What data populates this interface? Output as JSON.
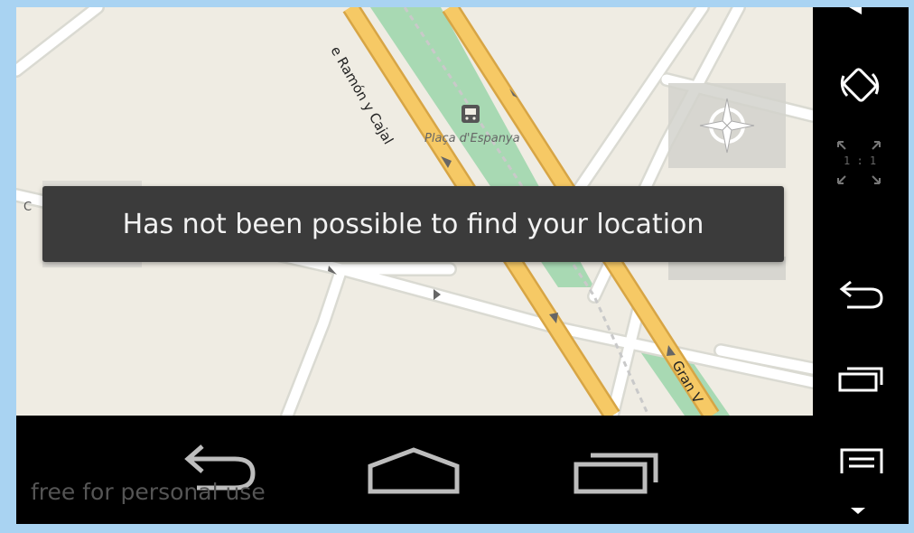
{
  "toast": {
    "message": "Has not been possible to find your location"
  },
  "map": {
    "station_label": "Plaça d'Espanya",
    "street_ramon": "e Ramón y Cajal",
    "street_gran": "Gran V",
    "street_left": "C"
  },
  "watermark": {
    "text": "free for personal use"
  },
  "side_nav": {
    "scale_label": "1 : 1"
  },
  "icons": {
    "rotate": "rotate-screen-icon",
    "back": "back-icon",
    "home": "home-icon",
    "recents": "recent-apps-icon",
    "menu": "menu-icon",
    "compass": "compass-icon",
    "scale": "scale-one-to-one-icon",
    "metro": "metro-station-icon"
  },
  "colors": {
    "map_background": "#efece3",
    "major_road": "#f6c965",
    "minor_road": "#ffffff",
    "park": "#9fd4ac",
    "nav_bar": "#000000",
    "toast_background": "#3b3b3b",
    "frame": "#a9d3f2"
  }
}
